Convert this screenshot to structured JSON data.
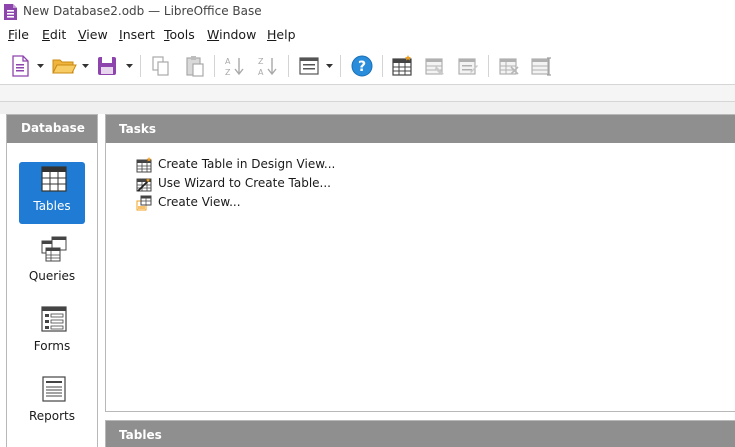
{
  "window": {
    "title": "New Database2.odb — LibreOffice Base"
  },
  "menu": [
    "File",
    "Edit",
    "View",
    "Insert",
    "Tools",
    "Window",
    "Help"
  ],
  "left_panel": {
    "header": "Database",
    "items": [
      {
        "label": "Tables",
        "icon": "table-icon",
        "selected": true
      },
      {
        "label": "Queries",
        "icon": "queries-icon",
        "selected": false
      },
      {
        "label": "Forms",
        "icon": "forms-icon",
        "selected": false
      },
      {
        "label": "Reports",
        "icon": "reports-icon",
        "selected": false
      }
    ]
  },
  "tasks_panel": {
    "header": "Tasks",
    "tasks": [
      {
        "label": "Create Table in Design View...",
        "icon": "table-design-icon"
      },
      {
        "label": "Use Wizard to Create Table...",
        "icon": "table-wizard-icon"
      },
      {
        "label": "Create View...",
        "icon": "create-view-icon"
      }
    ]
  },
  "tables_panel": {
    "header": "Tables"
  },
  "colors": {
    "selected": "#1f7bd3",
    "header_bg": "#8f8f8f",
    "app_accent": "#8e44ad"
  }
}
